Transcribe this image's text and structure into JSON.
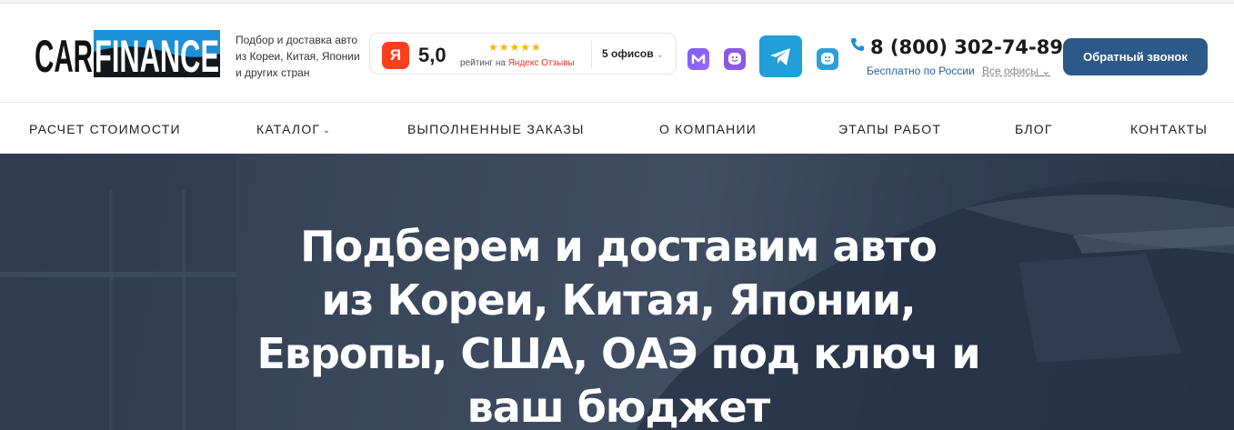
{
  "logo": {
    "part1": "CAR",
    "part2": "FINANCE",
    "accent": "#1c8fd6"
  },
  "tagline": "Подбор и доставка авто из Кореи, Китая, Японии и других стран",
  "rating": {
    "badge": "Я",
    "value": "5,0",
    "stars": "★★★★★",
    "caption_prefix": "рейтинг на",
    "caption_brand": "Яндекс Отзывы",
    "offices": "5 офисов",
    "offices_chevron": "⌄"
  },
  "messengers": [
    "max-icon",
    "viber-icon",
    "telegram-icon",
    "vk-icon"
  ],
  "contact": {
    "phone": "8 (800) 302-74-89",
    "free_text": "Бесплатно по России",
    "all_offices": "Все офисы",
    "all_offices_chevron": "⌄"
  },
  "callback_button": "Обратный звонок",
  "nav": {
    "items": [
      {
        "label": "РАСЧЕТ СТОИМОСТИ"
      },
      {
        "label": "КАТАЛОГ",
        "dropdown": "⌄"
      },
      {
        "label": "ВЫПОЛНЕННЫЕ ЗАКАЗЫ"
      },
      {
        "label": "О КОМПАНИИ"
      },
      {
        "label": "ЭТАПЫ РАБОТ"
      },
      {
        "label": "БЛОГ"
      },
      {
        "label": "КОНТАКТЫ"
      }
    ]
  },
  "hero": {
    "lines": [
      "Подберем и доставим авто",
      "из Кореи, Китая, Японии,",
      "Европы, США, ОАЭ под ключ и",
      "ваш бюджет"
    ]
  },
  "colors": {
    "brand_blue": "#2d5988",
    "telegram": "#229ed9",
    "yandex_red": "#fc3f1d",
    "star": "#f7b500"
  }
}
